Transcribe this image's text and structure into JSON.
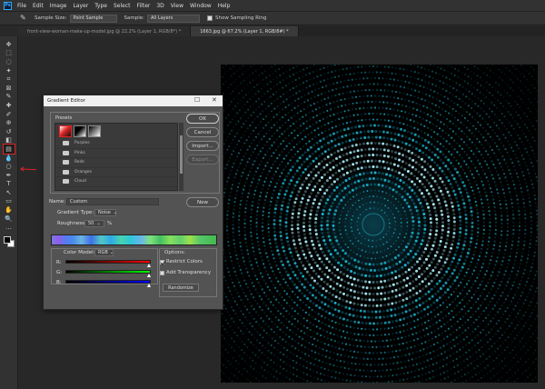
{
  "menu": {
    "logo": "Ps",
    "items": [
      "File",
      "Edit",
      "Image",
      "Layer",
      "Type",
      "Select",
      "Filter",
      "3D",
      "View",
      "Window",
      "Help"
    ]
  },
  "options": {
    "sample_size_label": "Sample Size:",
    "sample_size_value": "Point Sample",
    "sample_label": "Sample:",
    "sample_value": "All Layers",
    "sampling_ring_label": "Show Sampling Ring"
  },
  "tabs": [
    {
      "label": "front-view-woman-make-up-model.jpg @ 22.2% (Layer 1, RGB/8*) *",
      "active": false
    },
    {
      "label": "1663.jpg @ 67.2% (Layer 1, RGB/8#) *",
      "active": true
    }
  ],
  "tools": [
    "move-icon",
    "marquee-icon",
    "lasso-icon",
    "magic-wand-icon",
    "crop-icon",
    "frame-icon",
    "eyedropper-icon",
    "healing-icon",
    "brush-icon",
    "stamp-icon",
    "history-brush-icon",
    "eraser-icon",
    "gradient-icon",
    "blur-icon",
    "dodge-icon",
    "pen-icon",
    "type-icon",
    "path-selection-icon",
    "shape-icon",
    "hand-icon",
    "zoom-icon",
    "more-icon"
  ],
  "tool_glyphs": [
    "✥",
    "⬚",
    "◌",
    "✦",
    "⌗",
    "⊠",
    "✎",
    "✚",
    "✐",
    "⊕",
    "↺",
    "◧",
    "▤",
    "💧",
    "○",
    "✒",
    "T",
    "↖",
    "▭",
    "✋",
    "🔍",
    "…"
  ],
  "selected_tool_index": 12,
  "colors": {
    "foreground": "#000000",
    "background": "#ffffff",
    "highlight": "#e02424",
    "glow": "#1ec8e6"
  },
  "dialog": {
    "title": "Gradient Editor",
    "presets_label": "Presets",
    "folders": [
      "Purples",
      "Pinks",
      "Reds",
      "Oranges",
      "Cloud"
    ],
    "buttons": {
      "ok": "OK",
      "cancel": "Cancel",
      "import": "Import...",
      "export": "Export...",
      "new": "New"
    },
    "name_label": "Name:",
    "name_value": "Custom",
    "gradient_type_label": "Gradient Type:",
    "gradient_type_value": "Noise",
    "roughness_label": "Roughness:",
    "roughness_value": "50",
    "roughness_unit": "%",
    "color_model_label": "Color Model:",
    "color_model_value": "RGB",
    "channels": [
      {
        "label": "R:",
        "value": 0.98
      },
      {
        "label": "G:",
        "value": 0.98
      },
      {
        "label": "B:",
        "value": 0.98
      }
    ],
    "options_label": "Options:",
    "restrict_colors_label": "Restrict Colors",
    "restrict_colors_checked": true,
    "add_transparency_label": "Add Transparency",
    "add_transparency_checked": false,
    "randomize_label": "Randomize"
  }
}
